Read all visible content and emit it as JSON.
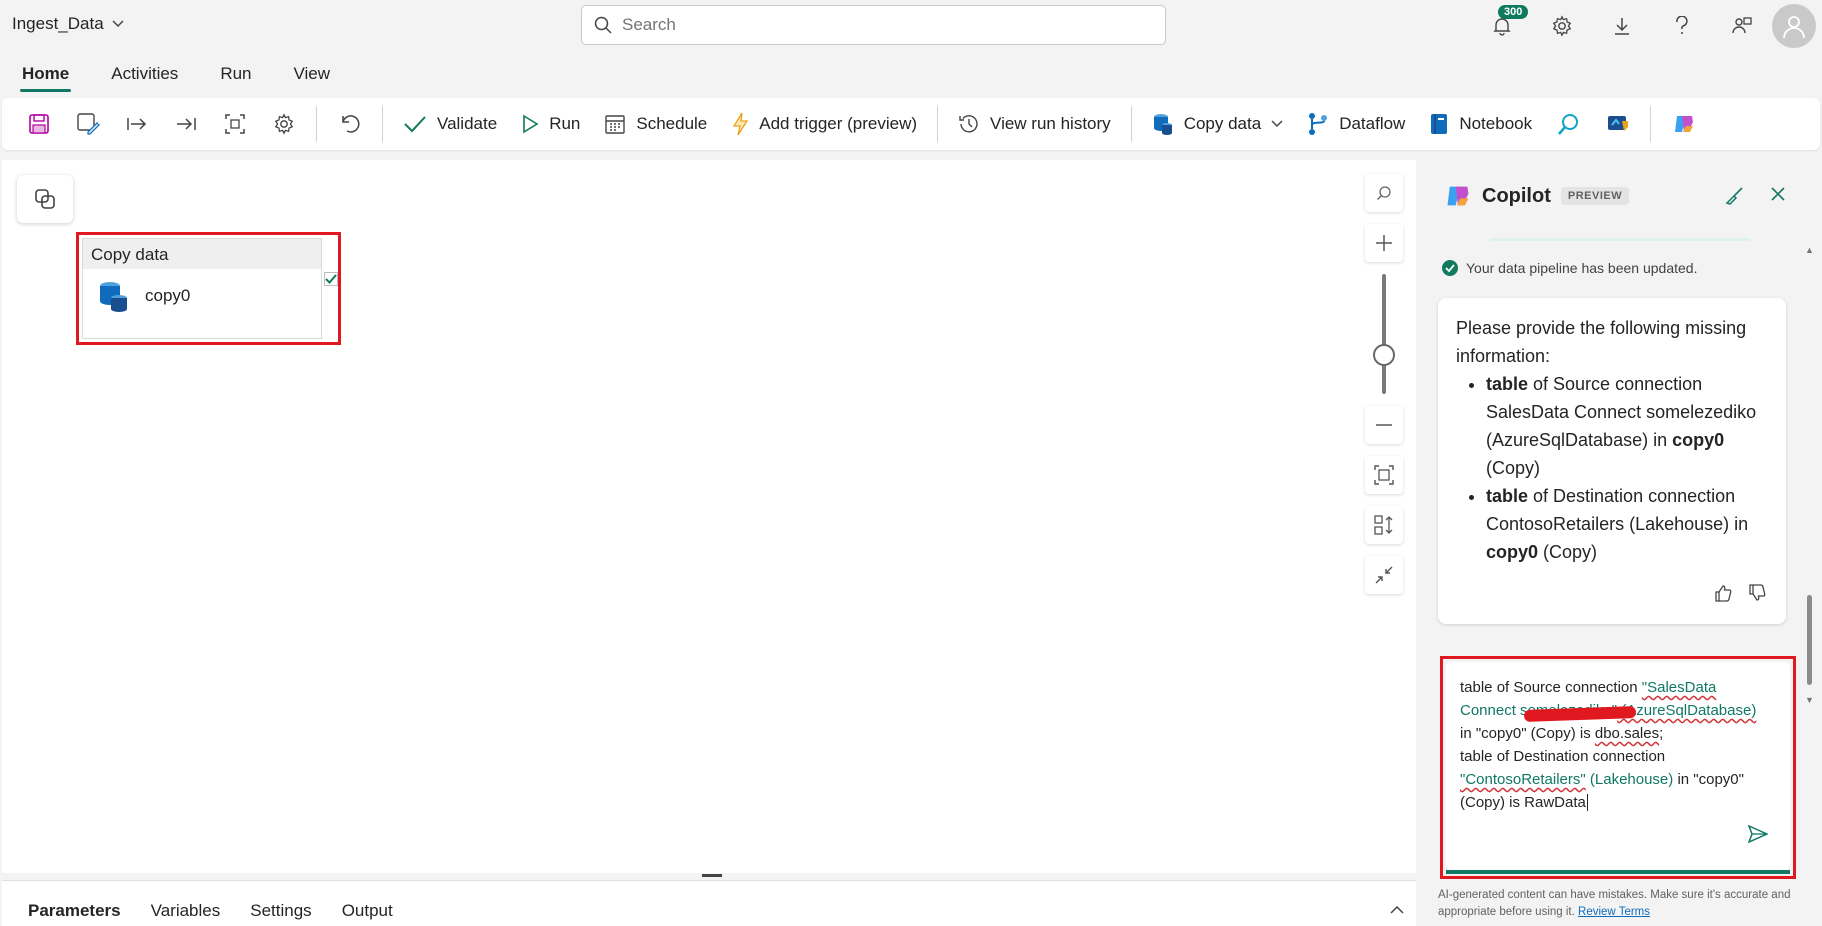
{
  "app": {
    "title": "Ingest_Data"
  },
  "search": {
    "placeholder": "Search"
  },
  "top_icons": {
    "notifications_count": "300"
  },
  "tabs": [
    {
      "label": "Home",
      "active": true
    },
    {
      "label": "Activities"
    },
    {
      "label": "Run"
    },
    {
      "label": "View"
    }
  ],
  "toolbar": {
    "validate": "Validate",
    "run": "Run",
    "schedule": "Schedule",
    "add_trigger": "Add trigger (preview)",
    "view_run_history": "View run history",
    "copy_data": "Copy data",
    "dataflow": "Dataflow",
    "notebook": "Notebook"
  },
  "canvas": {
    "activity": {
      "type": "Copy data",
      "name": "copy0"
    }
  },
  "bottom_tabs": [
    {
      "label": "Parameters",
      "active": true
    },
    {
      "label": "Variables"
    },
    {
      "label": "Settings"
    },
    {
      "label": "Output"
    }
  ],
  "copilot": {
    "title": "Copilot",
    "preview_badge": "PREVIEW",
    "status": "Your data pipeline has been updated.",
    "card": {
      "intro": "Please provide the following missing information:",
      "items": [
        {
          "bold1": "table",
          "text1": " of Source connection SalesData Connect somelezediko (AzureSqlDatabase) in ",
          "bold2": "copy0",
          "text2": " (Copy)"
        },
        {
          "bold1": "table",
          "text1": " of Destination connection ContosoRetailers (Lakehouse) in ",
          "bold2": "copy0",
          "text2": " (Copy)"
        }
      ]
    },
    "input": {
      "l1_a": "table of Source connection ",
      "l1_mention": "\"SalesData",
      "l2_mention": "Connect",
      "l2_hidden": " somelezediko\"",
      "l2_mention2": " (AzureSqlDatabase)",
      "l3_a": "in \"copy0\" (Copy) is ",
      "l3_b": "dbo.sales",
      "l3_c": ";",
      "l4": "table of Destination connection",
      "l5_mention": "\"ContosoRetailers\"",
      "l5_mention2": " (Lakehouse)",
      "l5_b": " in \"copy0\"",
      "l6": "(Copy) is RawData"
    },
    "footer": "AI-generated content can have mistakes. Make sure it's accurate and appropriate before using it.",
    "footer_link": "Review Terms"
  }
}
